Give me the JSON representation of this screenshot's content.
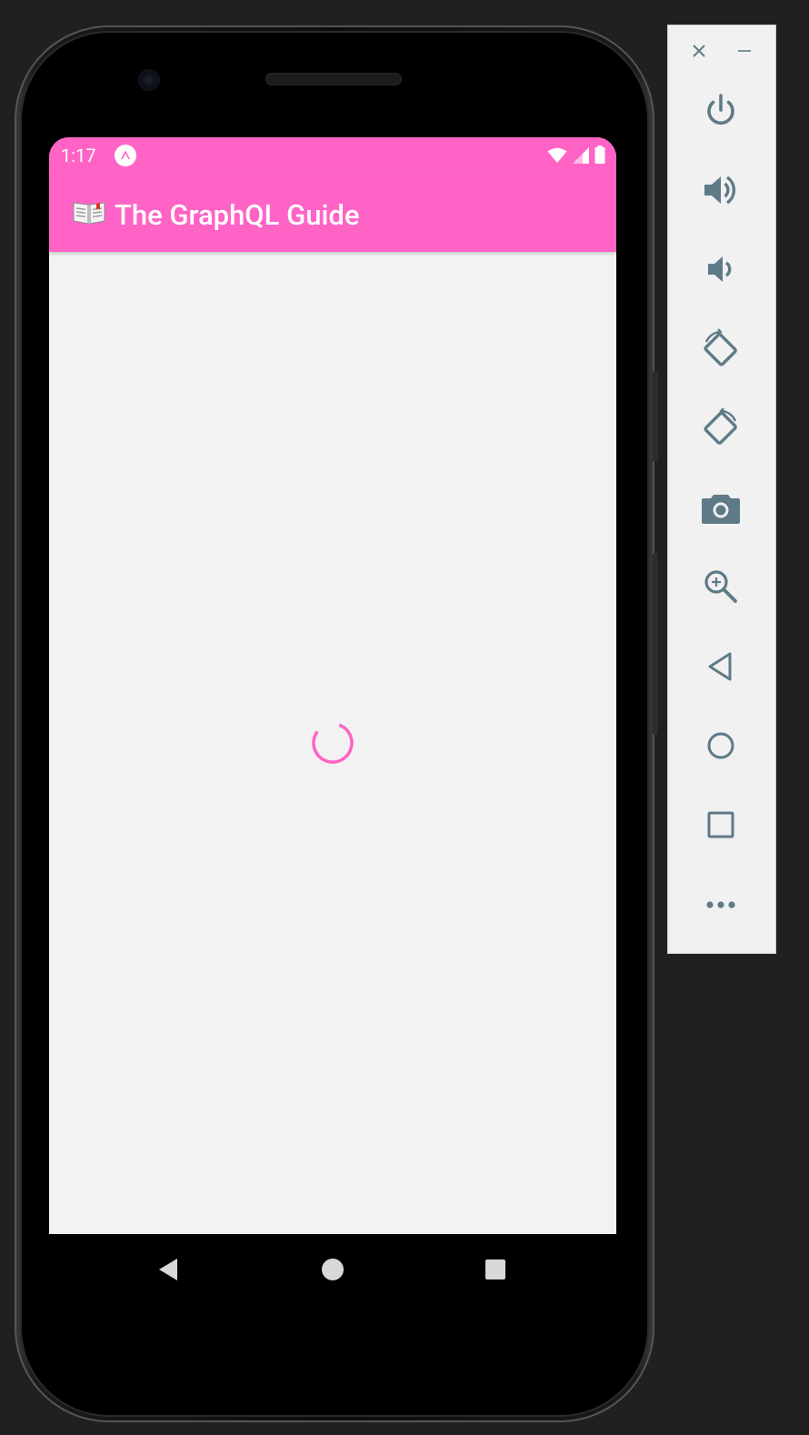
{
  "status_bar": {
    "time": "1:17"
  },
  "app_bar": {
    "title": "The GraphQL Guide",
    "background_color": "#ff63c6"
  },
  "content": {
    "state": "loading",
    "spinner_color": "#ff63c6",
    "background_color": "#f2f2f2"
  },
  "nav_bar": {
    "buttons": [
      "back",
      "home",
      "recents"
    ]
  },
  "emulator_toolbar": {
    "window_controls": [
      "close",
      "minimize"
    ],
    "buttons": [
      {
        "name": "power",
        "icon": "power-icon"
      },
      {
        "name": "volume-up",
        "icon": "volume-up-icon"
      },
      {
        "name": "volume-down",
        "icon": "volume-down-icon"
      },
      {
        "name": "rotate-left",
        "icon": "rotate-left-icon"
      },
      {
        "name": "rotate-right",
        "icon": "rotate-right-icon"
      },
      {
        "name": "screenshot",
        "icon": "camera-icon"
      },
      {
        "name": "zoom",
        "icon": "zoom-in-icon"
      },
      {
        "name": "back",
        "icon": "back-triangle-icon"
      },
      {
        "name": "home",
        "icon": "home-circle-icon"
      },
      {
        "name": "overview",
        "icon": "overview-square-icon"
      },
      {
        "name": "more",
        "icon": "more-dots-icon"
      }
    ],
    "icon_color": "#5f7a87"
  }
}
